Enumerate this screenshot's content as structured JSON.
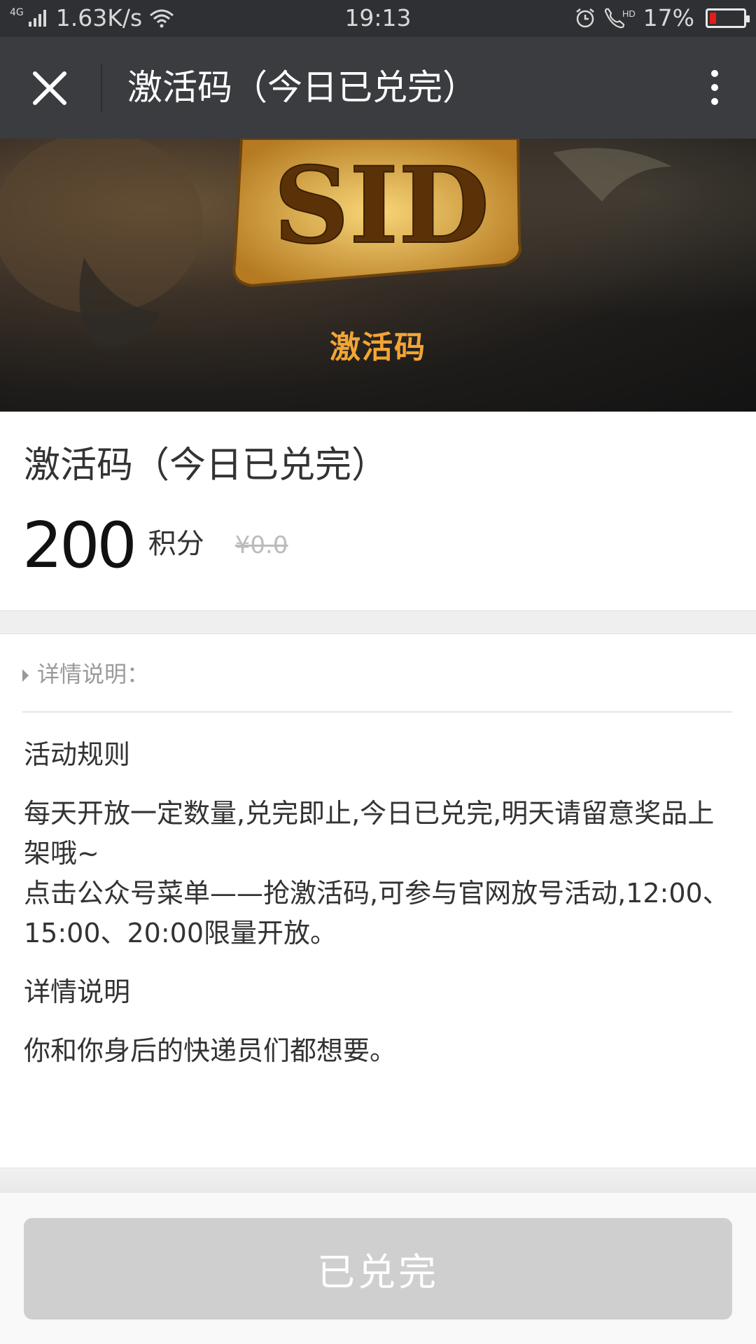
{
  "status_bar": {
    "network": "4G",
    "speed": "1.63K/s",
    "time": "19:13",
    "hd": "HD",
    "battery": "17%",
    "battery_level": 0.17
  },
  "nav": {
    "title": "激活码（今日已兑完）"
  },
  "banner": {
    "logo_text": "SID",
    "caption": "激活码"
  },
  "product": {
    "title": "激活码（今日已兑完）",
    "price": "200",
    "price_unit": "积分",
    "original_price": "¥0.0"
  },
  "details": {
    "label": "详情说明：",
    "heading1": "活动规则",
    "rule1": "每天开放一定数量,兑完即止,今日已兑完,明天请留意奖品上架哦~",
    "rule2": "点击公众号菜单——抢激活码,可参与官网放号活动,12:00、15:00、20:00限量开放。",
    "heading2": "详情说明",
    "desc": "你和你身后的快递员们都想要。"
  },
  "button": {
    "label": "已兑完"
  },
  "colors": {
    "nav_bg": "#3a3c40",
    "status_bg": "#2e3034",
    "banner_caption": "#f2a534",
    "button_disabled": "#cfcfcf"
  }
}
